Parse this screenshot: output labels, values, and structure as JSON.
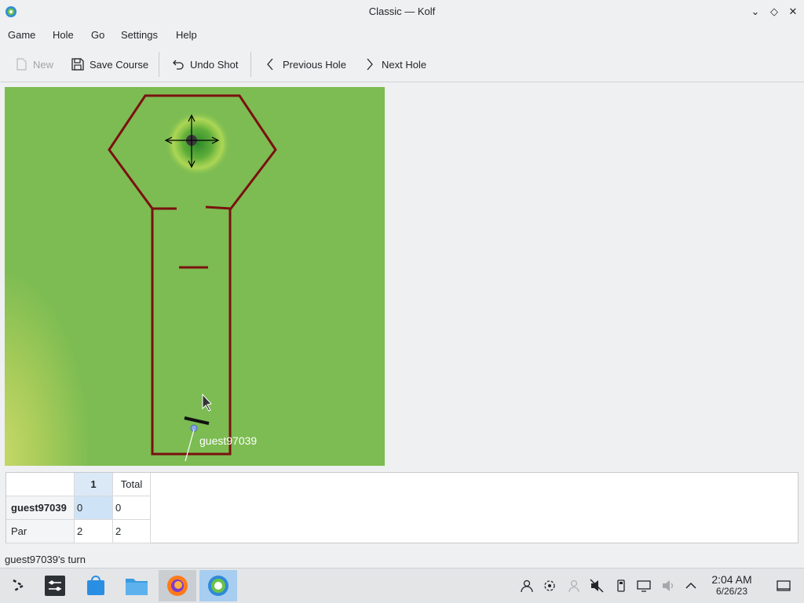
{
  "window": {
    "title": "Classic — Kolf"
  },
  "menu": [
    "Game",
    "Hole",
    "Go",
    "Settings",
    "Help"
  ],
  "toolbar": {
    "new_label": "New",
    "save_label": "Save Course",
    "undo_label": "Undo Shot",
    "prev_label": "Previous Hole",
    "next_label": "Next Hole"
  },
  "course": {
    "player_name": "guest97039"
  },
  "scoreboard": {
    "columns": [
      "1",
      "Total"
    ],
    "rows": [
      {
        "name": "guest97039",
        "values": [
          "0",
          "0"
        ]
      },
      {
        "name": "Par",
        "values": [
          "2",
          "2"
        ]
      }
    ]
  },
  "status": {
    "text": "guest97039's turn"
  },
  "taskbar": {
    "time": "2:04 AM",
    "date": "6/26/23",
    "apps": [
      "app-launcher",
      "system-settings",
      "discover",
      "file-manager",
      "firefox",
      "kolf"
    ]
  }
}
